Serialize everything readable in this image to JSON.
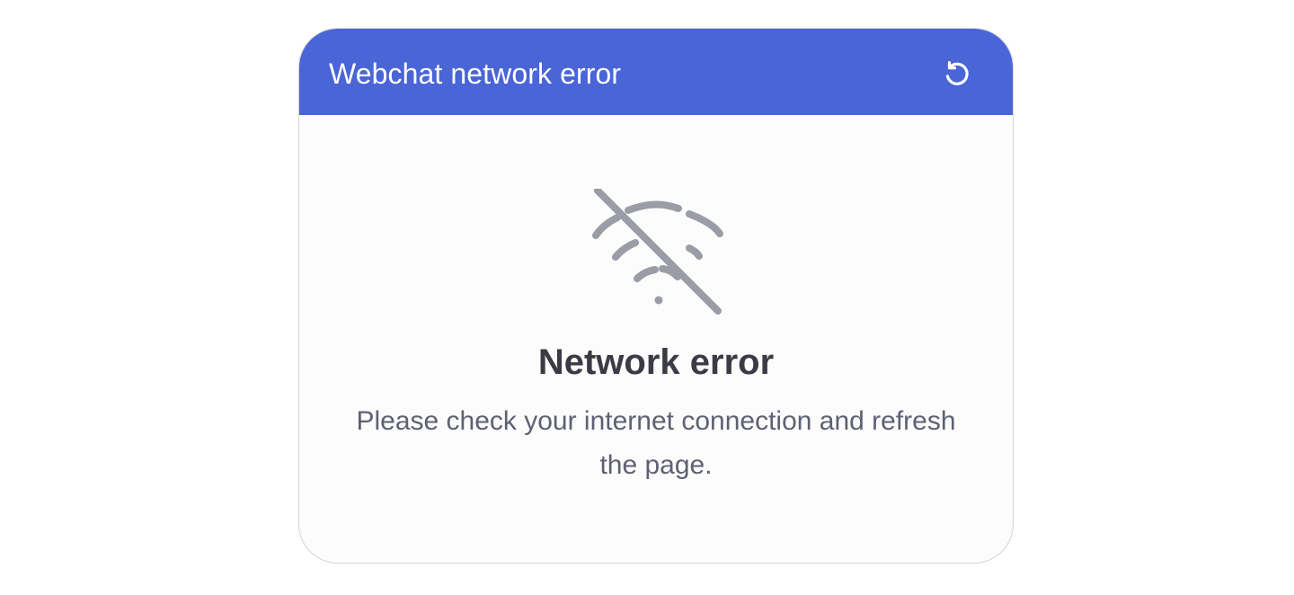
{
  "widget": {
    "header_title": "Webchat network error",
    "refresh_icon": "refresh-icon",
    "header_color": "#4a65d6"
  },
  "error": {
    "icon": "wifi-off-icon",
    "title": "Network error",
    "message": "Please check your internet connection and refresh the page."
  }
}
